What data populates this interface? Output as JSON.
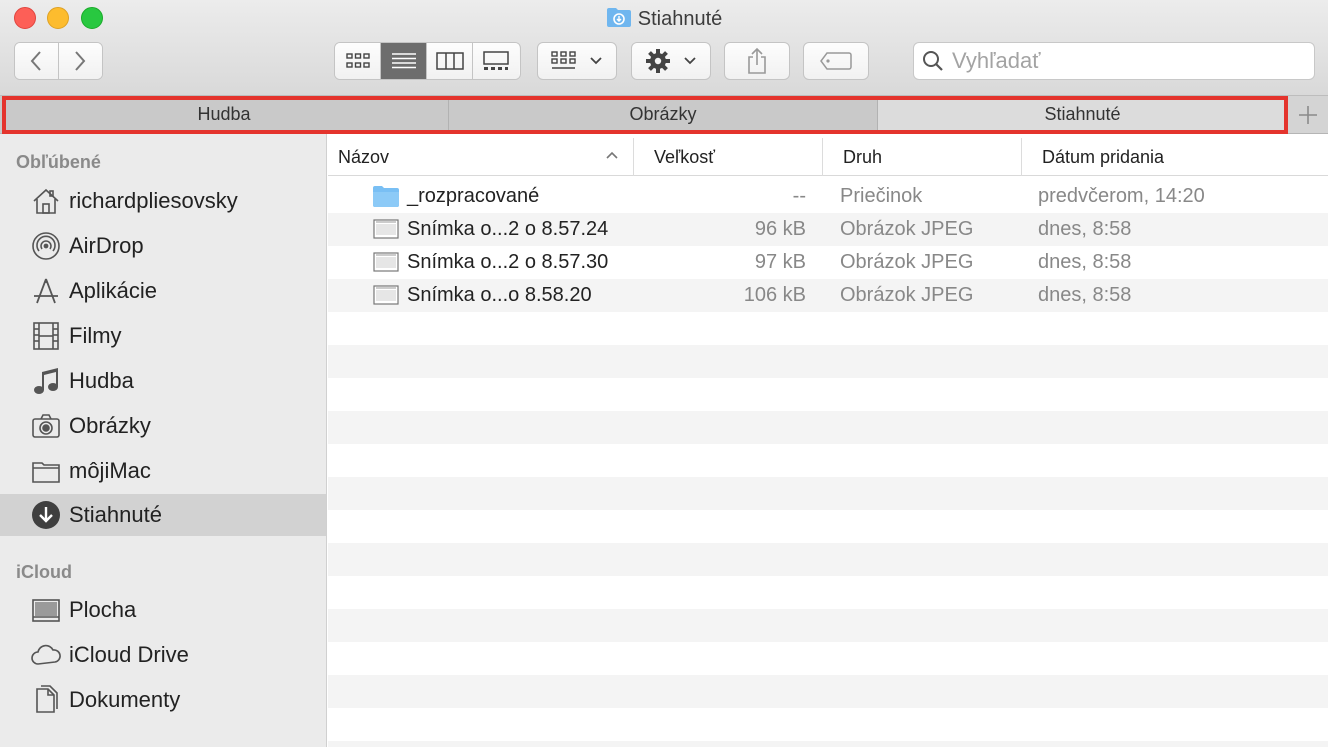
{
  "window": {
    "title": "Stiahnuté"
  },
  "search": {
    "placeholder": "Vyhľadať"
  },
  "tabs": [
    {
      "label": "Hudba"
    },
    {
      "label": "Obrázky"
    },
    {
      "label": "Stiahnuté"
    }
  ],
  "sidebar": {
    "favorites_title": "Obľúbené",
    "favorites": [
      {
        "label": "richardpliesovsky",
        "icon": "home-icon"
      },
      {
        "label": "AirDrop",
        "icon": "airdrop-icon"
      },
      {
        "label": "Aplikácie",
        "icon": "applications-icon"
      },
      {
        "label": "Filmy",
        "icon": "film-icon"
      },
      {
        "label": "Hudba",
        "icon": "music-note-icon"
      },
      {
        "label": "Obrázky",
        "icon": "camera-icon"
      },
      {
        "label": "môjiMac",
        "icon": "folder-icon"
      },
      {
        "label": "Stiahnuté",
        "icon": "download-icon"
      }
    ],
    "icloud_title": "iCloud",
    "icloud": [
      {
        "label": "Plocha",
        "icon": "desktop-icon"
      },
      {
        "label": "iCloud Drive",
        "icon": "cloud-icon"
      },
      {
        "label": "Dokumenty",
        "icon": "document-icon"
      }
    ]
  },
  "columns": {
    "name": "Názov",
    "size": "Veľkosť",
    "kind": "Druh",
    "date": "Dátum pridania"
  },
  "files": [
    {
      "name": "_rozpracované",
      "size": "--",
      "kind": "Priečinok",
      "date": "predvčerom, 14:20",
      "icon": "folder-icon"
    },
    {
      "name": "Snímka o...2 o 8.57.24",
      "size": "96 kB",
      "kind": "Obrázok JPEG",
      "date": "dnes, 8:58",
      "icon": "image-file-icon"
    },
    {
      "name": "Snímka o...2 o 8.57.30",
      "size": "97 kB",
      "kind": "Obrázok JPEG",
      "date": "dnes, 8:58",
      "icon": "image-file-icon"
    },
    {
      "name": "Snímka o...o 8.58.20",
      "size": "106 kB",
      "kind": "Obrázok JPEG",
      "date": "dnes, 8:58",
      "icon": "image-file-icon"
    }
  ],
  "colors": {
    "highlight": "#e4342d",
    "folder": "#6fb6ef",
    "selected": "#d2d2d2"
  }
}
